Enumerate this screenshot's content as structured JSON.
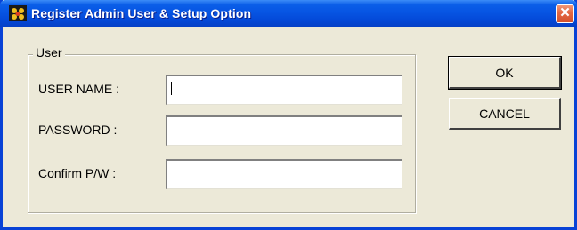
{
  "window": {
    "title": "Register Admin User &  Setup Option",
    "close_glyph": "✕"
  },
  "group": {
    "label": "User"
  },
  "fields": {
    "user_name": {
      "label": "USER NAME :",
      "value": ""
    },
    "password": {
      "label": "PASSWORD :",
      "value": ""
    },
    "confirm": {
      "label": "Confirm P/W  :",
      "value": ""
    }
  },
  "buttons": {
    "ok": "OK",
    "cancel": "CANCEL"
  },
  "icons": {
    "app": "app-icon",
    "close": "close-icon"
  },
  "colors": {
    "titlebar": "#0755e3",
    "close": "#e46a45",
    "face": "#ece9d8"
  }
}
